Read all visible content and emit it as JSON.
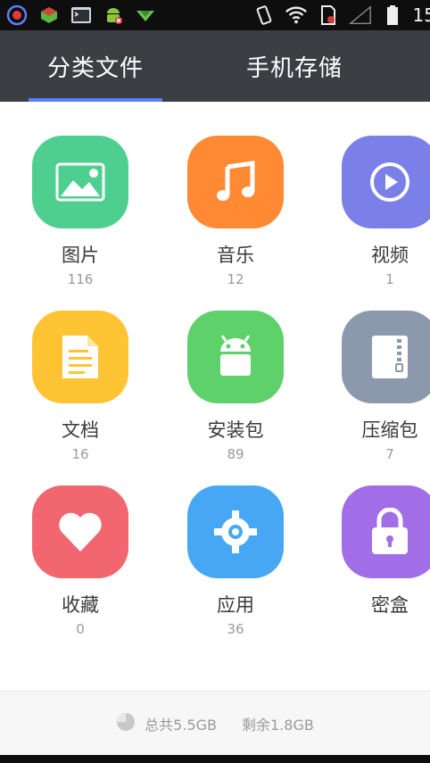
{
  "status_bar": {
    "time": "15",
    "left_icons": [
      "record-icon",
      "game-app-icon",
      "terminal-app-icon",
      "android-debug-icon",
      "download-arrow-icon"
    ],
    "right_icons": [
      "vibrate-icon",
      "wifi-icon",
      "sim-blocked-icon",
      "cell-signal-icon",
      "battery-icon"
    ]
  },
  "tabs": [
    {
      "label": "分类文件",
      "active": true
    },
    {
      "label": "手机存储",
      "active": false
    }
  ],
  "accent_color": "#5c7cff",
  "categories": [
    {
      "label": "图片",
      "count": "116",
      "color": "#4fcf8f",
      "icon": "image-icon"
    },
    {
      "label": "音乐",
      "count": "12",
      "color": "#ff8a33",
      "icon": "music-icon"
    },
    {
      "label": "视频",
      "count": "1",
      "color": "#7b7fe8",
      "icon": "video-play-icon"
    },
    {
      "label": "文档",
      "count": "16",
      "color": "#ffc434",
      "icon": "document-icon"
    },
    {
      "label": "安装包",
      "count": "89",
      "color": "#5ed16a",
      "icon": "android-icon"
    },
    {
      "label": "压缩包",
      "count": "7",
      "color": "#8c99ac",
      "icon": "zip-icon"
    },
    {
      "label": "收藏",
      "count": "0",
      "color": "#f26670",
      "icon": "heart-icon"
    },
    {
      "label": "应用",
      "count": "36",
      "color": "#47a7f5",
      "icon": "app-gear-icon"
    },
    {
      "label": "密盒",
      "count": "",
      "color": "#a16ee8",
      "icon": "lock-icon"
    }
  ],
  "storage": {
    "total": "总共5.5GB",
    "free": "剩余1.8GB",
    "icon": "storage-pie-icon"
  }
}
